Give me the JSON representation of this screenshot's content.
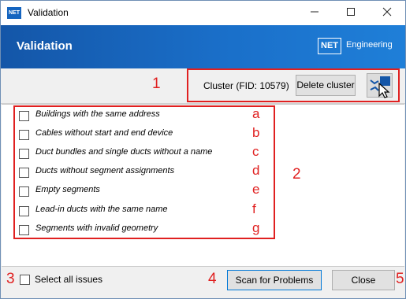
{
  "window": {
    "title": "Validation",
    "logo_text": "NET"
  },
  "header": {
    "title": "Validation",
    "brand_logo": "NET",
    "brand_text": "Engineering"
  },
  "cluster": {
    "label": "Cluster (FID: 10579)",
    "delete_button": "Delete cluster",
    "pick_icon": "map-pick-cursor-icon"
  },
  "issues": [
    {
      "label": "Buildings with the same address",
      "annotation": "a"
    },
    {
      "label": "Cables without start and end device",
      "annotation": "b"
    },
    {
      "label": "Duct bundles and single ducts without a name",
      "annotation": "c"
    },
    {
      "label": "Ducts without segment assignments",
      "annotation": "d"
    },
    {
      "label": "Empty segments",
      "annotation": "e"
    },
    {
      "label": "Lead-in ducts with the same name",
      "annotation": "f"
    },
    {
      "label": "Segments with invalid geometry",
      "annotation": "g"
    }
  ],
  "footer": {
    "select_all_label": "Select all issues",
    "scan_button": "Scan for Problems",
    "close_button": "Close"
  },
  "annotations": {
    "n1": "1",
    "n2": "2",
    "n3": "3",
    "n4": "4",
    "n5": "5"
  },
  "colors": {
    "header_blue": "#1a6fc9",
    "annotation_red": "#e02020"
  }
}
